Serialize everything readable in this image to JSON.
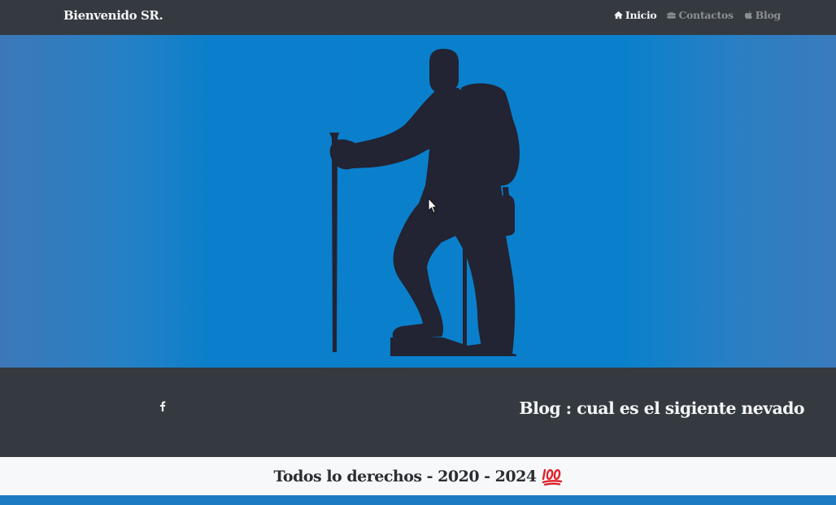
{
  "navbar": {
    "brand": "Bienvenido SR.",
    "links": [
      {
        "label": "Inicio",
        "icon": "home-icon",
        "active": true
      },
      {
        "label": "Contactos",
        "icon": "briefcase-icon",
        "active": false
      },
      {
        "label": "Blog",
        "icon": "apple-icon",
        "active": false
      }
    ]
  },
  "hero": {
    "image": "hiker-silhouette"
  },
  "footer": {
    "social_icon": "facebook-icon",
    "blog_title": "Blog : cual es el sigiente nevado",
    "copyright": "Todos lo derechos - 2020 - 2024",
    "copyright_emoji": "hundred-points-icon"
  },
  "colors": {
    "navbar_bg": "#343a40",
    "hero_blue": "#0a80cc",
    "silhouette": "#222333",
    "text_light": "#f4f4f4",
    "copyright_bg": "#f7f8f9",
    "emoji_red": "#e0212b"
  }
}
